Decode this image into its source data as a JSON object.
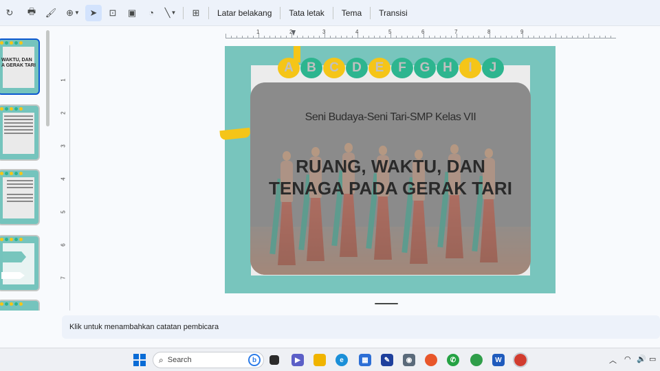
{
  "toolbar": {
    "menu_background": "Latar belakang",
    "menu_layout": "Tata letak",
    "menu_theme": "Tema",
    "menu_transition": "Transisi"
  },
  "ruler": {
    "h_numbers": [
      "1",
      "2",
      "3",
      "4",
      "5",
      "6",
      "7",
      "8",
      "9"
    ],
    "v_numbers": [
      "1",
      "2",
      "3",
      "4",
      "5",
      "6",
      "7"
    ]
  },
  "slide": {
    "letters": [
      "A",
      "B",
      "C",
      "D",
      "E",
      "F",
      "G",
      "H",
      "I",
      "J"
    ],
    "subtitle": "Seni Budaya-Seni Tari-SMP Kelas VII",
    "title_line1": "RUANG, WAKTU, DAN",
    "title_line2": "TENAGA PADA GERAK TARI"
  },
  "thumbnails": {
    "thumb1_text_line1": "WAKTU, DAN",
    "thumb1_text_line2": "A GERAK TARI"
  },
  "notes": {
    "placeholder": "Klik untuk menambahkan catatan pembicara"
  },
  "taskbar": {
    "search_label": "Search"
  },
  "colors": {
    "accent_blue": "#0b57d0",
    "slide_teal": "#78c5bd",
    "dot_yellow": "#f5c518",
    "dot_green": "#2db58f"
  }
}
